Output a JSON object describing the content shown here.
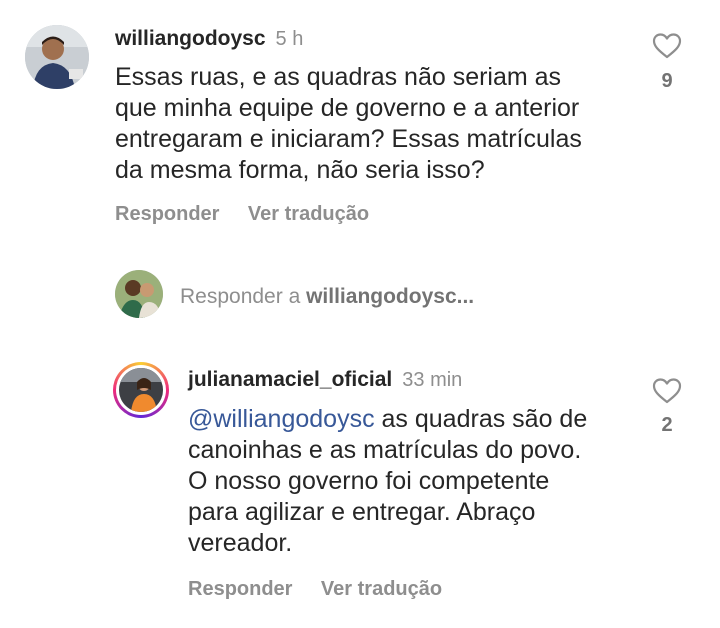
{
  "comments": [
    {
      "username": "williangodoysc",
      "time": "5 h",
      "text_lines": [
        "Essas ruas, e as quadras não seriam as",
        "que minha equipe de governo e a anterior",
        "entregaram e iniciaram? Essas matrículas",
        "da mesma forma, não seria isso?"
      ],
      "likes": "9",
      "reply_label": "Responder",
      "translate_label": "Ver tradução"
    },
    {
      "username": "julianamaciel_oficial",
      "time": "33 min",
      "mention": "@williangodoysc",
      "text_first_rest": " as quadras são de",
      "text_lines": [
        "canoinhas e as matrículas do povo.",
        "O nosso governo foi competente",
        "para agilizar e entregar. Abraço",
        "vereador."
      ],
      "likes": "2",
      "reply_label": "Responder",
      "translate_label": "Ver tradução"
    }
  ],
  "reply_box": {
    "prompt": "Responder a ",
    "target": "williangodoysc..."
  },
  "icons": {
    "like": "heart-outline-icon"
  },
  "colors": {
    "mention": "#385898",
    "muted": "#8e8e8e",
    "story_ring": "#d62976"
  }
}
